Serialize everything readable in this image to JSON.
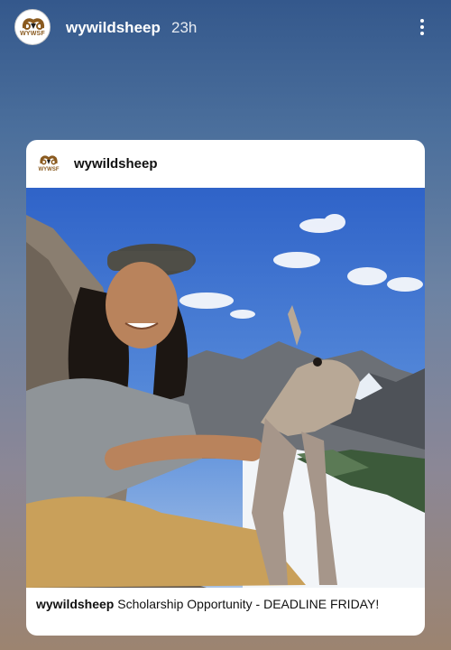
{
  "story": {
    "username": "wywildsheep",
    "time_ago": "23h",
    "avatar_text": "WYWSF",
    "icons": {
      "more": "more-vertical-icon",
      "avatar_logo": "ram-logo"
    }
  },
  "post": {
    "username": "wywildsheep",
    "avatar_text": "WYWSF",
    "caption_user": "wywildsheep",
    "caption_text": "Scholarship Opportunity - DEADLINE FRIDAY!"
  },
  "colors": {
    "background_top": "#34588c",
    "background_bottom": "#9c8470",
    "logo_brown": "#8a5a1f",
    "card": "#ffffff"
  }
}
